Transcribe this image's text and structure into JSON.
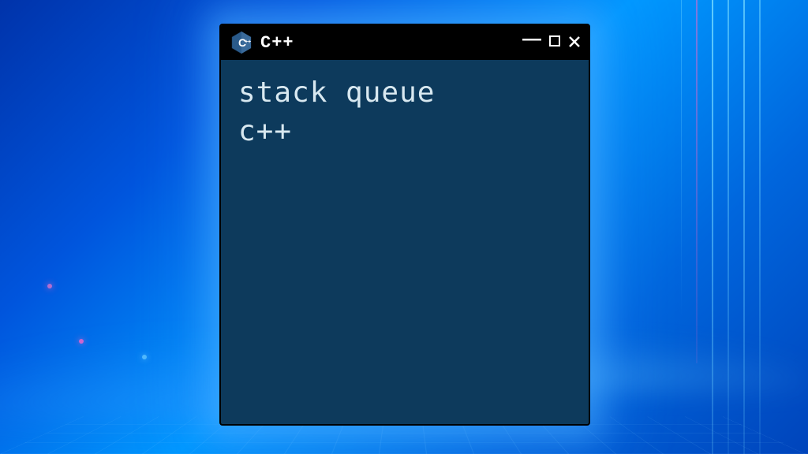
{
  "window": {
    "title": "C++",
    "icon_letter": "C",
    "controls": {
      "minimize": "—",
      "maximize": "☐",
      "close": "✕"
    }
  },
  "content": {
    "line1": "stack queue",
    "line2": "c++"
  },
  "colors": {
    "window_bg": "#0d3a5c",
    "titlebar_bg": "#000000",
    "text": "#d8e8f0",
    "icon_bg": "#2a5a8a",
    "icon_fg": "#ffffff"
  }
}
